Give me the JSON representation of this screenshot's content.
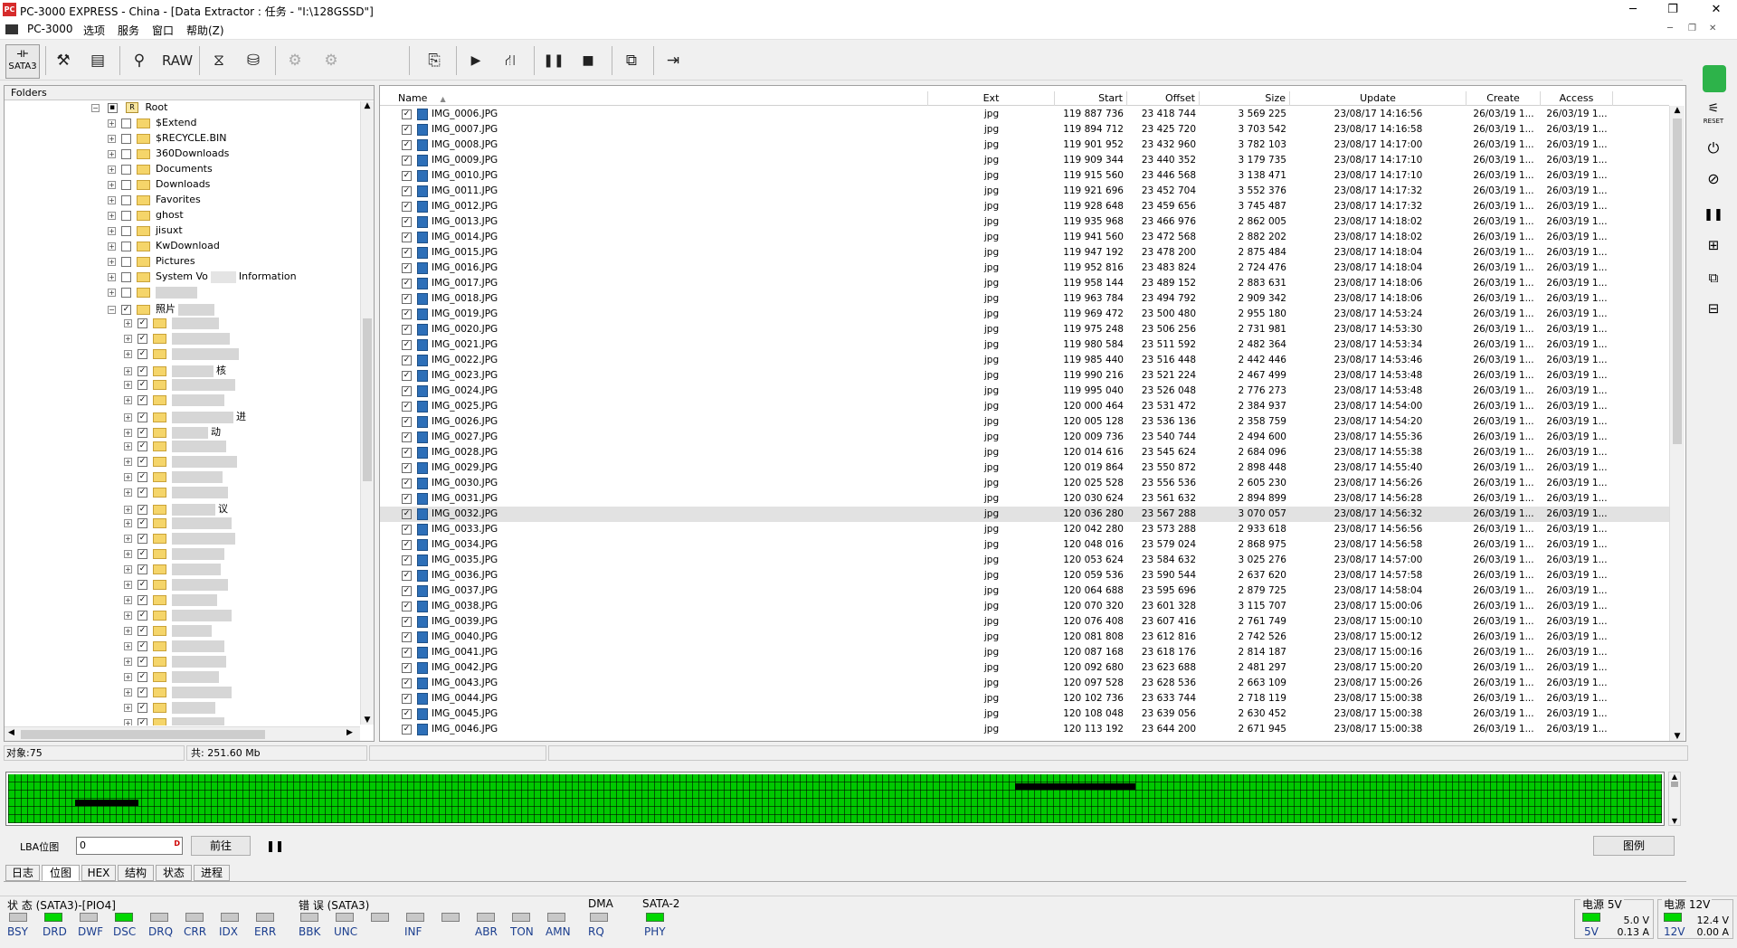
{
  "window": {
    "title": "PC-3000 EXPRESS - China - [Data Extractor : 任务 - \"I:\\128GSSD\"]",
    "app_icon": "pc3000-logo-icon",
    "min": "─",
    "max": "❐",
    "close": "✕"
  },
  "menu": {
    "items": [
      "PC-3000",
      "选项",
      "服务",
      "窗口",
      "帮助(Z)"
    ]
  },
  "toolbar": {
    "sata_label": "SATA3",
    "raw_label": "RAW"
  },
  "folders": {
    "header": "Folders",
    "root": "Root",
    "items": [
      "$Extend",
      "$RECYCLE.BIN",
      "360Downloads",
      "Documents",
      "Downloads",
      "Favorites",
      "ghost",
      "jisuxt",
      "KwDownload",
      "Pictures",
      "System Vo",
      "Information"
    ],
    "photo_folder": "照片",
    "partial_texts": [
      "核",
      "进",
      "动",
      "议"
    ]
  },
  "files": {
    "columns": [
      "Name",
      "Ext",
      "Start",
      "Offset",
      "Size",
      "Update",
      "Create",
      "Access"
    ],
    "rows": [
      [
        "IMG_0006.JPG",
        "jpg",
        "119 887 736",
        "23 418 744",
        "3 569 225",
        "23/08/17 14:16:56",
        "26/03/19 1...",
        "26/03/19 1..."
      ],
      [
        "IMG_0007.JPG",
        "jpg",
        "119 894 712",
        "23 425 720",
        "3 703 542",
        "23/08/17 14:16:58",
        "26/03/19 1...",
        "26/03/19 1..."
      ],
      [
        "IMG_0008.JPG",
        "jpg",
        "119 901 952",
        "23 432 960",
        "3 782 103",
        "23/08/17 14:17:00",
        "26/03/19 1...",
        "26/03/19 1..."
      ],
      [
        "IMG_0009.JPG",
        "jpg",
        "119 909 344",
        "23 440 352",
        "3 179 735",
        "23/08/17 14:17:10",
        "26/03/19 1...",
        "26/03/19 1..."
      ],
      [
        "IMG_0010.JPG",
        "jpg",
        "119 915 560",
        "23 446 568",
        "3 138 471",
        "23/08/17 14:17:10",
        "26/03/19 1...",
        "26/03/19 1..."
      ],
      [
        "IMG_0011.JPG",
        "jpg",
        "119 921 696",
        "23 452 704",
        "3 552 376",
        "23/08/17 14:17:32",
        "26/03/19 1...",
        "26/03/19 1..."
      ],
      [
        "IMG_0012.JPG",
        "jpg",
        "119 928 648",
        "23 459 656",
        "3 745 487",
        "23/08/17 14:17:32",
        "26/03/19 1...",
        "26/03/19 1..."
      ],
      [
        "IMG_0013.JPG",
        "jpg",
        "119 935 968",
        "23 466 976",
        "2 862 005",
        "23/08/17 14:18:02",
        "26/03/19 1...",
        "26/03/19 1..."
      ],
      [
        "IMG_0014.JPG",
        "jpg",
        "119 941 560",
        "23 472 568",
        "2 882 202",
        "23/08/17 14:18:02",
        "26/03/19 1...",
        "26/03/19 1..."
      ],
      [
        "IMG_0015.JPG",
        "jpg",
        "119 947 192",
        "23 478 200",
        "2 875 484",
        "23/08/17 14:18:04",
        "26/03/19 1...",
        "26/03/19 1..."
      ],
      [
        "IMG_0016.JPG",
        "jpg",
        "119 952 816",
        "23 483 824",
        "2 724 476",
        "23/08/17 14:18:04",
        "26/03/19 1...",
        "26/03/19 1..."
      ],
      [
        "IMG_0017.JPG",
        "jpg",
        "119 958 144",
        "23 489 152",
        "2 883 631",
        "23/08/17 14:18:06",
        "26/03/19 1...",
        "26/03/19 1..."
      ],
      [
        "IMG_0018.JPG",
        "jpg",
        "119 963 784",
        "23 494 792",
        "2 909 342",
        "23/08/17 14:18:06",
        "26/03/19 1...",
        "26/03/19 1..."
      ],
      [
        "IMG_0019.JPG",
        "jpg",
        "119 969 472",
        "23 500 480",
        "2 955 180",
        "23/08/17 14:53:24",
        "26/03/19 1...",
        "26/03/19 1..."
      ],
      [
        "IMG_0020.JPG",
        "jpg",
        "119 975 248",
        "23 506 256",
        "2 731 981",
        "23/08/17 14:53:30",
        "26/03/19 1...",
        "26/03/19 1..."
      ],
      [
        "IMG_0021.JPG",
        "jpg",
        "119 980 584",
        "23 511 592",
        "2 482 364",
        "23/08/17 14:53:34",
        "26/03/19 1...",
        "26/03/19 1..."
      ],
      [
        "IMG_0022.JPG",
        "jpg",
        "119 985 440",
        "23 516 448",
        "2 442 446",
        "23/08/17 14:53:46",
        "26/03/19 1...",
        "26/03/19 1..."
      ],
      [
        "IMG_0023.JPG",
        "jpg",
        "119 990 216",
        "23 521 224",
        "2 467 499",
        "23/08/17 14:53:48",
        "26/03/19 1...",
        "26/03/19 1..."
      ],
      [
        "IMG_0024.JPG",
        "jpg",
        "119 995 040",
        "23 526 048",
        "2 776 273",
        "23/08/17 14:53:48",
        "26/03/19 1...",
        "26/03/19 1..."
      ],
      [
        "IMG_0025.JPG",
        "jpg",
        "120 000 464",
        "23 531 472",
        "2 384 937",
        "23/08/17 14:54:00",
        "26/03/19 1...",
        "26/03/19 1..."
      ],
      [
        "IMG_0026.JPG",
        "jpg",
        "120 005 128",
        "23 536 136",
        "2 358 759",
        "23/08/17 14:54:20",
        "26/03/19 1...",
        "26/03/19 1..."
      ],
      [
        "IMG_0027.JPG",
        "jpg",
        "120 009 736",
        "23 540 744",
        "2 494 600",
        "23/08/17 14:55:36",
        "26/03/19 1...",
        "26/03/19 1..."
      ],
      [
        "IMG_0028.JPG",
        "jpg",
        "120 014 616",
        "23 545 624",
        "2 684 096",
        "23/08/17 14:55:38",
        "26/03/19 1...",
        "26/03/19 1..."
      ],
      [
        "IMG_0029.JPG",
        "jpg",
        "120 019 864",
        "23 550 872",
        "2 898 448",
        "23/08/17 14:55:40",
        "26/03/19 1...",
        "26/03/19 1..."
      ],
      [
        "IMG_0030.JPG",
        "jpg",
        "120 025 528",
        "23 556 536",
        "2 605 230",
        "23/08/17 14:56:26",
        "26/03/19 1...",
        "26/03/19 1..."
      ],
      [
        "IMG_0031.JPG",
        "jpg",
        "120 030 624",
        "23 561 632",
        "2 894 899",
        "23/08/17 14:56:28",
        "26/03/19 1...",
        "26/03/19 1..."
      ],
      [
        "IMG_0032.JPG",
        "jpg",
        "120 036 280",
        "23 567 288",
        "3 070 057",
        "23/08/17 14:56:32",
        "26/03/19 1...",
        "26/03/19 1..."
      ],
      [
        "IMG_0033.JPG",
        "jpg",
        "120 042 280",
        "23 573 288",
        "2 933 618",
        "23/08/17 14:56:56",
        "26/03/19 1...",
        "26/03/19 1..."
      ],
      [
        "IMG_0034.JPG",
        "jpg",
        "120 048 016",
        "23 579 024",
        "2 868 975",
        "23/08/17 14:56:58",
        "26/03/19 1...",
        "26/03/19 1..."
      ],
      [
        "IMG_0035.JPG",
        "jpg",
        "120 053 624",
        "23 584 632",
        "3 025 276",
        "23/08/17 14:57:00",
        "26/03/19 1...",
        "26/03/19 1..."
      ],
      [
        "IMG_0036.JPG",
        "jpg",
        "120 059 536",
        "23 590 544",
        "2 637 620",
        "23/08/17 14:57:58",
        "26/03/19 1...",
        "26/03/19 1..."
      ],
      [
        "IMG_0037.JPG",
        "jpg",
        "120 064 688",
        "23 595 696",
        "2 879 725",
        "23/08/17 14:58:04",
        "26/03/19 1...",
        "26/03/19 1..."
      ],
      [
        "IMG_0038.JPG",
        "jpg",
        "120 070 320",
        "23 601 328",
        "3 115 707",
        "23/08/17 15:00:06",
        "26/03/19 1...",
        "26/03/19 1..."
      ],
      [
        "IMG_0039.JPG",
        "jpg",
        "120 076 408",
        "23 607 416",
        "2 761 749",
        "23/08/17 15:00:10",
        "26/03/19 1...",
        "26/03/19 1..."
      ],
      [
        "IMG_0040.JPG",
        "jpg",
        "120 081 808",
        "23 612 816",
        "2 742 526",
        "23/08/17 15:00:12",
        "26/03/19 1...",
        "26/03/19 1..."
      ],
      [
        "IMG_0041.JPG",
        "jpg",
        "120 087 168",
        "23 618 176",
        "2 814 187",
        "23/08/17 15:00:16",
        "26/03/19 1...",
        "26/03/19 1..."
      ],
      [
        "IMG_0042.JPG",
        "jpg",
        "120 092 680",
        "23 623 688",
        "2 481 297",
        "23/08/17 15:00:20",
        "26/03/19 1...",
        "26/03/19 1..."
      ],
      [
        "IMG_0043.JPG",
        "jpg",
        "120 097 528",
        "23 628 536",
        "2 663 109",
        "23/08/17 15:00:26",
        "26/03/19 1...",
        "26/03/19 1..."
      ],
      [
        "IMG_0044.JPG",
        "jpg",
        "120 102 736",
        "23 633 744",
        "2 718 119",
        "23/08/17 15:00:38",
        "26/03/19 1...",
        "26/03/19 1..."
      ],
      [
        "IMG_0045.JPG",
        "jpg",
        "120 108 048",
        "23 639 056",
        "2 630 452",
        "23/08/17 15:00:38",
        "26/03/19 1...",
        "26/03/19 1..."
      ],
      [
        "IMG_0046.JPG",
        "jpg",
        "120 113 192",
        "23 644 200",
        "2 671 945",
        "23/08/17 15:00:38",
        "26/03/19 1...",
        "26/03/19 1..."
      ]
    ],
    "selected_row": "IMG_0032.JPG"
  },
  "status": {
    "objects": "对象:75",
    "total": "共: 251.60 Mb"
  },
  "bitmap": {
    "lba_label": "LBA位图",
    "lba_value": "0",
    "go_button": "前往",
    "legend_button": "图例",
    "pause": "❚❚"
  },
  "tabs": [
    "日志",
    "位图",
    "HEX",
    "结构",
    "状态",
    "进程"
  ],
  "active_tab": "位图",
  "leds": {
    "state_title": "状 态 (SATA3)-[PIO4]",
    "state": [
      [
        "BSY",
        false
      ],
      [
        "DRD",
        true
      ],
      [
        "DWF",
        false
      ],
      [
        "DSC",
        true
      ],
      [
        "DRQ",
        false
      ],
      [
        "CRR",
        false
      ],
      [
        "IDX",
        false
      ],
      [
        "ERR",
        false
      ]
    ],
    "error_title": "错 误 (SATA3)",
    "error": [
      [
        "BBK",
        false
      ],
      [
        "UNC",
        false
      ],
      [
        "",
        false
      ],
      [
        "INF",
        false
      ],
      [
        "",
        false
      ],
      [
        "ABR",
        false
      ],
      [
        "TON",
        false
      ],
      [
        "AMN",
        false
      ]
    ],
    "dma_title": "DMA",
    "dma": [
      [
        "RQ",
        false
      ]
    ],
    "sata2_title": "SATA-2",
    "sata2": [
      [
        "PHY",
        true
      ]
    ]
  },
  "power": {
    "p5_title": "电源 5V",
    "p5_label": "5V",
    "p5_volt": "5.0 V",
    "p5_amp": "0.13 A",
    "p12_title": "电源 12V",
    "p12_label": "12V",
    "p12_volt": "12.4 V",
    "p12_amp": "0.00 A"
  },
  "right_panel": {
    "reset_label": "RESET"
  },
  "colors": {
    "map_ok": "#00c800",
    "led_on": "#00d800",
    "led_label": "#1a3d8e"
  }
}
